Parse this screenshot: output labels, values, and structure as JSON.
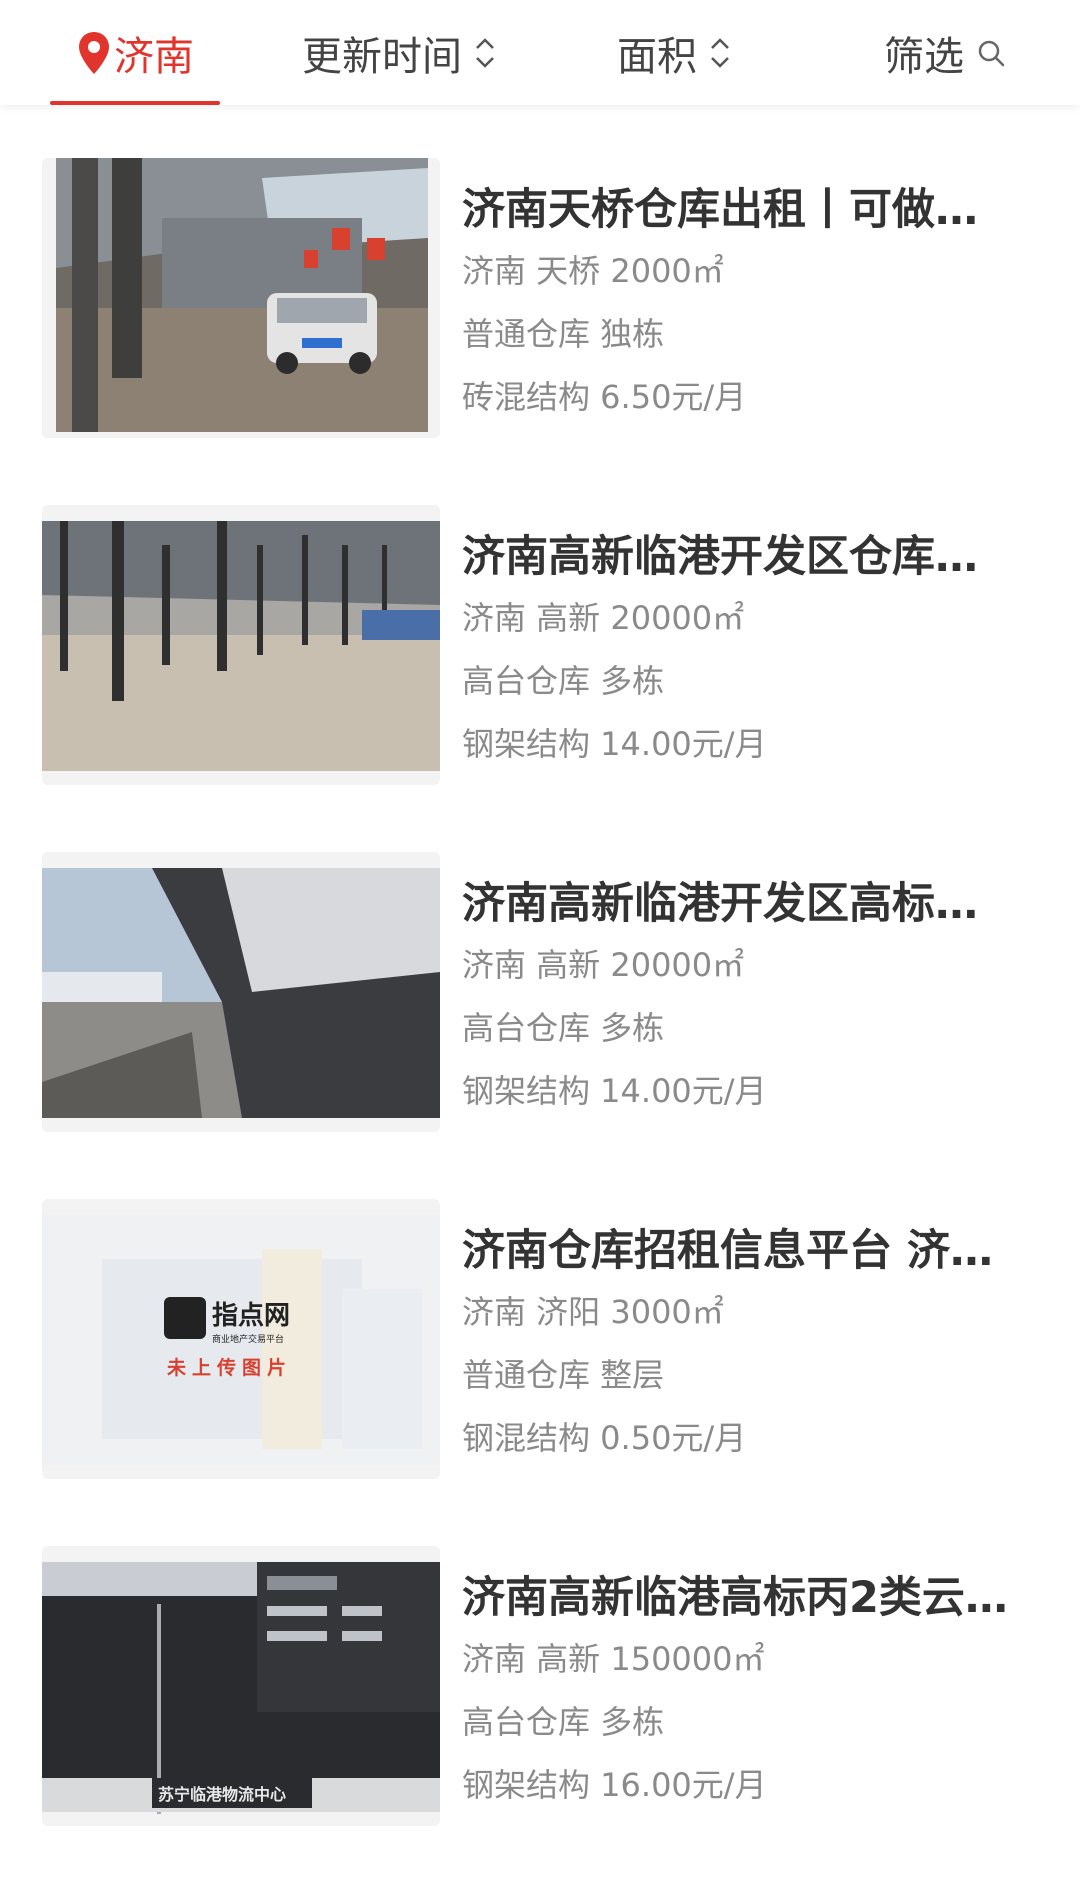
{
  "filter_bar": {
    "city": "济南",
    "update_time": "更新时间",
    "area": "面积",
    "filter": "筛选"
  },
  "colors": {
    "accent": "#e0342c",
    "title": "#333333",
    "meta": "#8a8a8a"
  },
  "listings": [
    {
      "title": "济南天桥仓库出租丨可做…",
      "location": "济南 天桥 2000㎡",
      "type": "普通仓库 独栋",
      "price": "砖混结构 6.50元/月"
    },
    {
      "title": "济南高新临港开发区仓库…",
      "location": "济南 高新 20000㎡",
      "type": "高台仓库 多栋",
      "price": "钢架结构 14.00元/月"
    },
    {
      "title": "济南高新临港开发区高标…",
      "location": "济南 高新 20000㎡",
      "type": "高台仓库 多栋",
      "price": "钢架结构 14.00元/月"
    },
    {
      "title": "济南仓库招租信息平台 济…",
      "location": "济南 济阳 3000㎡",
      "type": "普通仓库 整层",
      "price": "钢混结构 0.50元/月",
      "placeholder_logo": "指点网",
      "placeholder_subtitle": "商业地产交易平台",
      "placeholder_text": "未上传图片"
    },
    {
      "title": "济南高新临港高标丙2类云…",
      "location": "济南 高新 150000㎡",
      "type": "高台仓库 多栋",
      "price": "钢架结构 16.00元/月",
      "sign_text": "苏宁临港物流中心"
    }
  ]
}
